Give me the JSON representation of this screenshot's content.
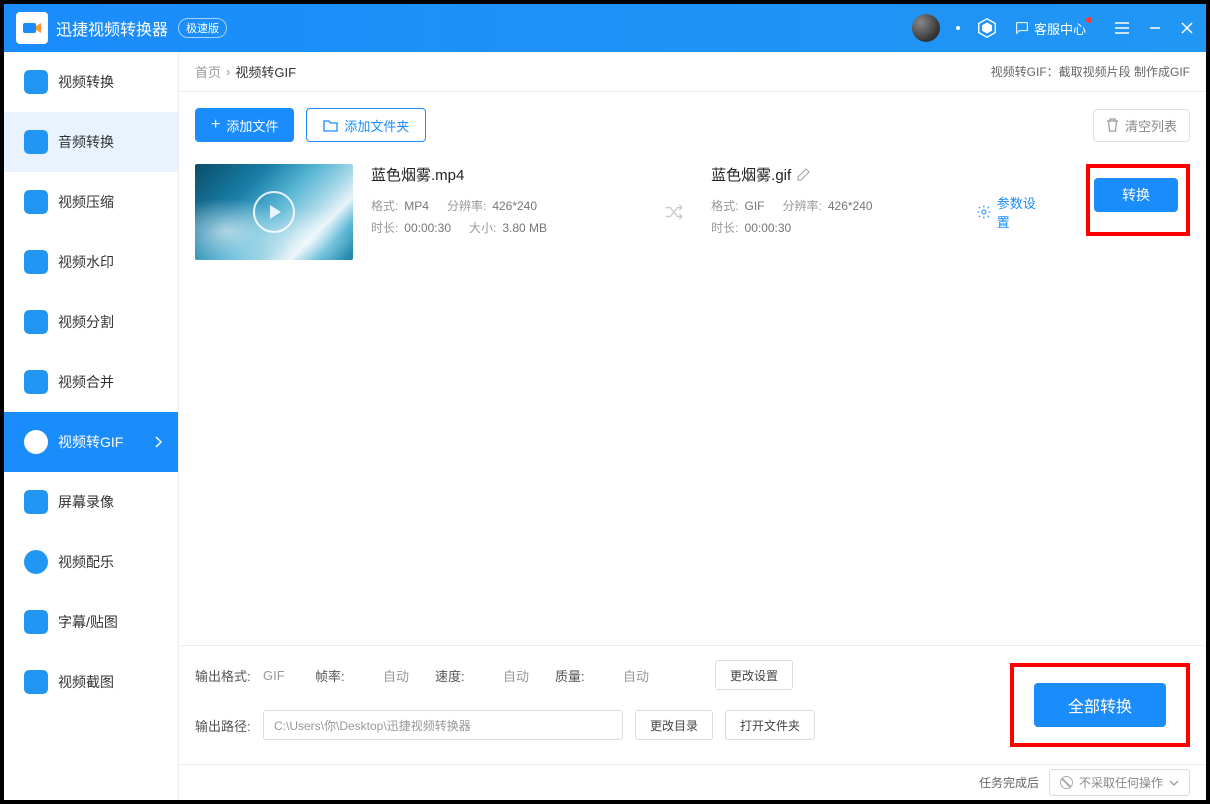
{
  "titlebar": {
    "app_name": "迅捷视频转换器",
    "edition": "极速版",
    "support": "客服中心"
  },
  "sidebar": {
    "items": [
      {
        "label": "视频转换"
      },
      {
        "label": "音频转换"
      },
      {
        "label": "视频压缩"
      },
      {
        "label": "视频水印"
      },
      {
        "label": "视频分割"
      },
      {
        "label": "视频合并"
      },
      {
        "label": "视频转GIF"
      },
      {
        "label": "屏幕录像"
      },
      {
        "label": "视频配乐"
      },
      {
        "label": "字幕/贴图"
      },
      {
        "label": "视频截图"
      }
    ]
  },
  "breadcrumb": {
    "home": "首页",
    "current": "视频转GIF",
    "desc": "视频转GIF：截取视频片段 制作成GIF"
  },
  "toolbar": {
    "add_file": "添加文件",
    "add_folder": "添加文件夹",
    "clear_list": "清空列表"
  },
  "file": {
    "src_name": "蓝色烟雾.mp4",
    "src_format_label": "格式:",
    "src_format": "MP4",
    "src_res_label": "分辨率:",
    "src_res": "426*240",
    "src_dur_label": "时长:",
    "src_dur": "00:00:30",
    "src_size_label": "大小:",
    "src_size": "3.80 MB",
    "dst_name": "蓝色烟雾.gif",
    "dst_format_label": "格式:",
    "dst_format": "GIF",
    "dst_res_label": "分辨率:",
    "dst_res": "426*240",
    "dst_dur_label": "时长:",
    "dst_dur": "00:00:30",
    "params": "参数设置",
    "convert": "转换"
  },
  "output": {
    "format_label": "输出格式:",
    "format": "GIF",
    "fps_label": "帧率:",
    "fps": "自动",
    "speed_label": "速度:",
    "speed": "自动",
    "quality_label": "质量:",
    "quality": "自动",
    "change_settings": "更改设置",
    "path_label": "输出路径:",
    "path": "C:\\Users\\你\\Desktop\\迅捷视频转换器",
    "change_dir": "更改目录",
    "open_folder": "打开文件夹",
    "convert_all": "全部转换"
  },
  "footer": {
    "after_label": "任务完成后",
    "action": "不采取任何操作"
  }
}
